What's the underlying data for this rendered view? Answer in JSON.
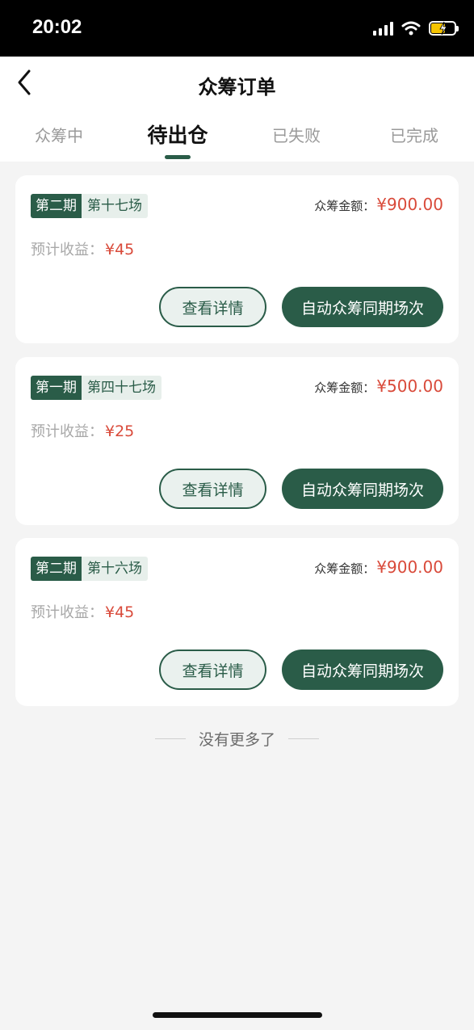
{
  "status_bar": {
    "time": "20:02"
  },
  "header": {
    "title": "众筹订单"
  },
  "tabs": [
    {
      "label": "众筹中",
      "active": false
    },
    {
      "label": "待出仓",
      "active": true
    },
    {
      "label": "已失败",
      "active": false
    },
    {
      "label": "已完成",
      "active": false
    }
  ],
  "orders": [
    {
      "period": "第二期",
      "session": "第十七场",
      "amount_label": "众筹金额：",
      "amount": "¥900.00",
      "income_label": "预计收益：",
      "income": "¥45",
      "detail_label": "查看详情",
      "auto_label": "自动众筹同期场次"
    },
    {
      "period": "第一期",
      "session": "第四十七场",
      "amount_label": "众筹金额：",
      "amount": "¥500.00",
      "income_label": "预计收益：",
      "income": "¥25",
      "detail_label": "查看详情",
      "auto_label": "自动众筹同期场次"
    },
    {
      "period": "第二期",
      "session": "第十六场",
      "amount_label": "众筹金额：",
      "amount": "¥900.00",
      "income_label": "预计收益：",
      "income": "¥45",
      "detail_label": "查看详情",
      "auto_label": "自动众筹同期场次"
    }
  ],
  "footer": {
    "end_text": "没有更多了"
  },
  "colors": {
    "primary": "#2a5c48",
    "price": "#d94a3a",
    "background": "#f4f4f4"
  }
}
